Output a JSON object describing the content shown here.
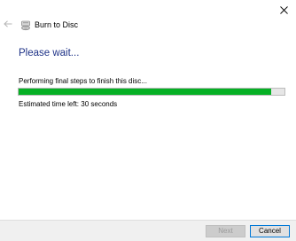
{
  "window": {
    "title": "Burn to Disc",
    "icons": {
      "close": "close-icon",
      "back": "back-arrow-icon",
      "app": "burn-disc-icon"
    }
  },
  "content": {
    "heading": "Please wait...",
    "status": "Performing final steps to finish this disc...",
    "progress": {
      "fraction": 0.95,
      "color": "#06b025"
    },
    "time_left": "Estimated time left: 30 seconds"
  },
  "footer": {
    "next_label": "Next",
    "next_enabled": false,
    "cancel_label": "Cancel"
  },
  "colors": {
    "heading": "#1e3287",
    "accent_border": "#0078d7"
  }
}
